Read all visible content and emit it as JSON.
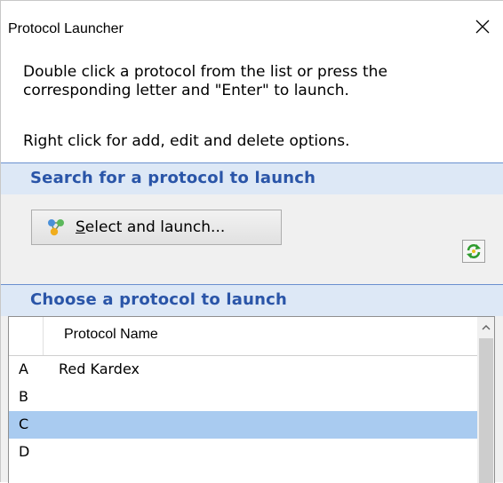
{
  "window": {
    "title": "Protocol Launcher",
    "close_glyph": "✕"
  },
  "instructions": {
    "line1": "Double click a protocol from the list or press the",
    "line2": "corresponding letter and \"Enter\" to launch.",
    "line3": "Right click for add, edit and delete options."
  },
  "search_section": {
    "title": "Search for a protocol to launch",
    "select_button": {
      "hotkey": "S",
      "label_rest": "elect and launch...",
      "icon": "molecule-icon"
    },
    "refresh_icon": "refresh-icon"
  },
  "choose_section": {
    "title": "Choose a protocol to launch"
  },
  "grid": {
    "column_header": "Protocol Name",
    "rows": [
      {
        "letter": "A",
        "name": "Red Kardex",
        "selected": false
      },
      {
        "letter": "B",
        "name": "",
        "selected": false
      },
      {
        "letter": "C",
        "name": "",
        "selected": true
      },
      {
        "letter": "D",
        "name": "",
        "selected": false
      }
    ]
  },
  "colors": {
    "section_header_bg": "#dde8f6",
    "section_title": "#2a55a8",
    "selected_row": "#a9cbf0"
  }
}
